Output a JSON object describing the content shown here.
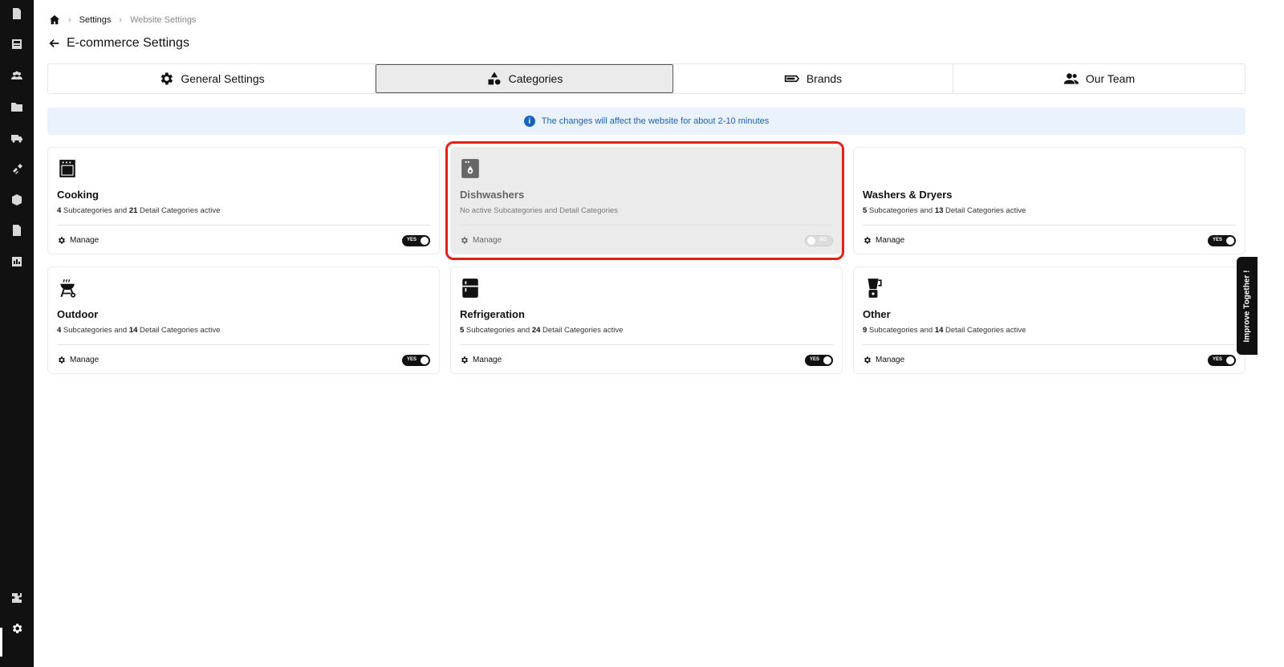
{
  "sidebar": {
    "items": [
      {
        "name": "orders-icon"
      },
      {
        "name": "catalog-icon"
      },
      {
        "name": "customers-icon"
      },
      {
        "name": "folders-icon"
      },
      {
        "name": "shipping-icon"
      },
      {
        "name": "integrations-icon"
      },
      {
        "name": "inventory-icon"
      },
      {
        "name": "documents-icon"
      },
      {
        "name": "reports-icon"
      },
      {
        "name": "plugins-icon"
      },
      {
        "name": "settings-icon",
        "active": true
      }
    ]
  },
  "breadcrumb": {
    "home_icon": "home-icon",
    "items": [
      "Settings",
      "Website Settings"
    ]
  },
  "page": {
    "title": "E-commerce Settings",
    "back_icon": "arrow-left-icon"
  },
  "tabs": [
    {
      "label": "General Settings",
      "icon": "gear-icon",
      "active": false
    },
    {
      "label": "Categories",
      "icon": "shapes-icon",
      "active": true
    },
    {
      "label": "Brands",
      "icon": "brand-tag-icon",
      "active": false
    },
    {
      "label": "Our Team",
      "icon": "people-icon",
      "active": false
    }
  ],
  "banner": {
    "text": "The changes will affect the website for about 2-10 minutes",
    "icon": "info-icon"
  },
  "categories": [
    {
      "name": "Cooking",
      "icon": "oven-icon",
      "desc_pre": "4",
      "desc_mid": " Subcategories and ",
      "desc_num2": "21",
      "desc_post": " Detail Categories active",
      "manage_label": "Manage",
      "toggle": "YES",
      "enabled": true
    },
    {
      "name": "Dishwashers",
      "icon": "dishwasher-icon",
      "desc_full": "No active Subcategories and Detail Categories",
      "manage_label": "Manage",
      "toggle": "NO",
      "enabled": false
    },
    {
      "name": "Washers & Dryers",
      "icon": "washer-icon",
      "desc_pre": "5",
      "desc_mid": " Subcategories and ",
      "desc_num2": "13",
      "desc_post": " Detail Categories active",
      "manage_label": "Manage",
      "toggle": "YES",
      "enabled": true
    },
    {
      "name": "Outdoor",
      "icon": "grill-icon",
      "desc_pre": "4",
      "desc_mid": " Subcategories and ",
      "desc_num2": "14",
      "desc_post": " Detail Categories active",
      "manage_label": "Manage",
      "toggle": "YES",
      "enabled": true
    },
    {
      "name": "Refrigeration",
      "icon": "fridge-icon",
      "desc_pre": "5",
      "desc_mid": " Subcategories and ",
      "desc_num2": "24",
      "desc_post": " Detail Categories active",
      "manage_label": "Manage",
      "toggle": "YES",
      "enabled": true
    },
    {
      "name": "Other",
      "icon": "blender-icon",
      "desc_pre": "9",
      "desc_mid": " Subcategories and ",
      "desc_num2": "14",
      "desc_post": " Detail Categories active",
      "manage_label": "Manage",
      "toggle": "YES",
      "enabled": true
    }
  ],
  "feedback": {
    "label": "Improve Together !"
  },
  "colors": {
    "highlight": "#e52117",
    "banner_bg": "#eaf3fd",
    "banner_text": "#1d5fb5",
    "sidebar_bg": "#111111"
  }
}
